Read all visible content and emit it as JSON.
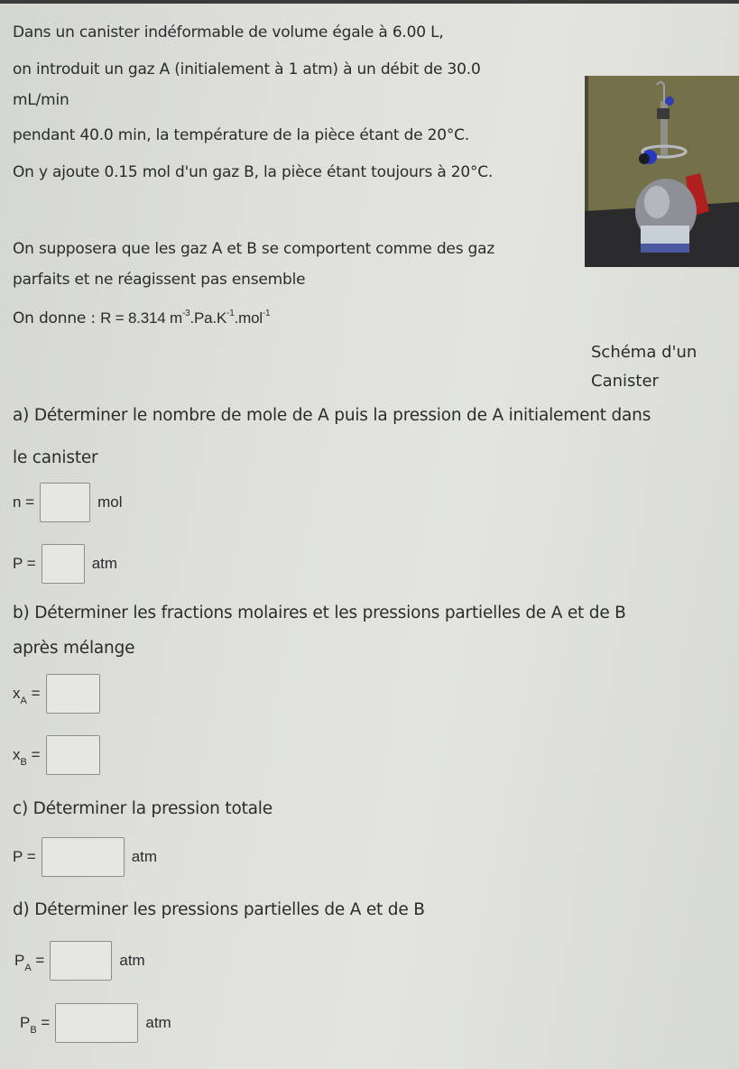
{
  "statement": {
    "line1": "Dans un canister indéformable de volume égale à 6.00 L,",
    "line2": "on introduit un gaz A (initialement à 1 atm) à un débit de 30.0",
    "line3": "mL/min",
    "line4": "pendant 40.0 min, la température de la pièce étant de 20°C.",
    "line5": "On y ajoute 0.15 mol d'un gaz B, la pièce étant toujours à 20°C.",
    "line6": "On supposera que les gaz A et B se comportent comme des gaz",
    "line7": "parfaits et ne réagissent pas ensemble",
    "given_prefix": "On donne :",
    "given_formula": "R = 8.314 m",
    "given_exp1": "-3",
    "given_mid1": ".Pa.K",
    "given_exp2": "-1",
    "given_mid2": ".mol",
    "given_exp3": "-1"
  },
  "figure": {
    "image": "canister-photo",
    "caption_line1": "Schéma d'un",
    "caption_line2": "Canister"
  },
  "questions": {
    "a": {
      "text_line1": "a) Déterminer le nombre de mole de A puis la pression de A initialement dans",
      "text_line2": "le canister",
      "fields": [
        {
          "label": "n =",
          "sub": "",
          "unit": "mol",
          "value": ""
        },
        {
          "label": "P =",
          "sub": "",
          "unit": "atm",
          "value": ""
        }
      ]
    },
    "b": {
      "text_line1": "b) Déterminer les fractions molaires et les pressions partielles de A et de B",
      "text_line2": "après mélange",
      "fields": [
        {
          "label": "x",
          "sub": "A",
          "eq": "=",
          "unit": "",
          "value": ""
        },
        {
          "label": "x",
          "sub": "B",
          "eq": "=",
          "unit": "",
          "value": ""
        }
      ]
    },
    "c": {
      "text_line1": "c) Déterminer la pression totale",
      "fields": [
        {
          "label": "P =",
          "sub": "",
          "unit": "atm",
          "value": ""
        }
      ]
    },
    "d": {
      "text_line1": "d) Déterminer les pressions partielles de A et de B",
      "fields": [
        {
          "label": "P",
          "sub": "A",
          "eq": "=",
          "unit": "atm",
          "value": ""
        },
        {
          "label": "P",
          "sub": "B",
          "eq": "=",
          "unit": "atm",
          "value": ""
        }
      ]
    }
  }
}
